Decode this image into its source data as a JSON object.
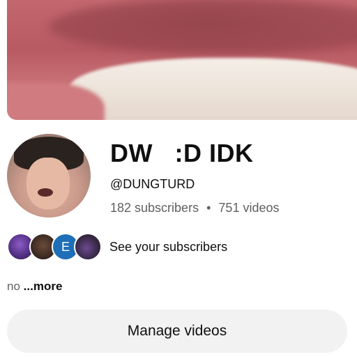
{
  "channel": {
    "name": "DW   :D IDK",
    "handle": "@DUNGTURD",
    "subscribers": "182 subscribers",
    "separator": "•",
    "videos": "751 videos"
  },
  "subscribers_preview": {
    "badge_letter": "E",
    "label": "See your subscribers"
  },
  "description": {
    "text": "no",
    "more_label": "...more"
  },
  "actions": {
    "manage_videos_label": "Manage videos"
  }
}
